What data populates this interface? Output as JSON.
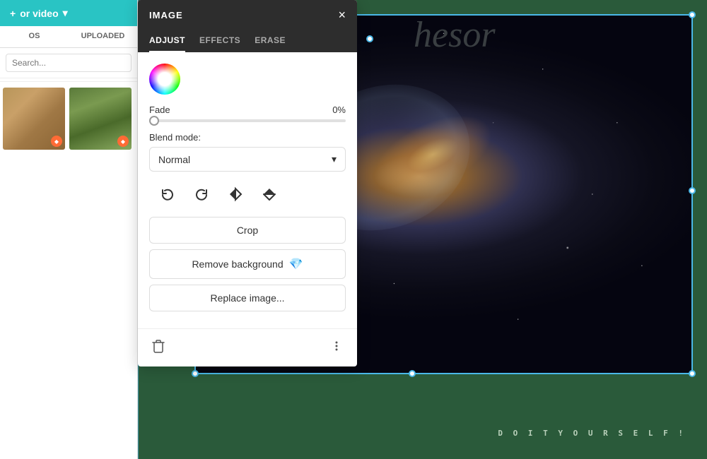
{
  "sidebar": {
    "top_button": "or video",
    "tabs": [
      {
        "label": "OS",
        "active": false
      },
      {
        "label": "UPLOADED",
        "active": false
      }
    ],
    "search_placeholder": "Search...",
    "images": [
      {
        "id": "rocks",
        "type": "rocks",
        "has_badge": true
      },
      {
        "id": "aerial",
        "type": "aerial",
        "has_badge": true
      }
    ]
  },
  "panel": {
    "title": "IMAGE",
    "close_label": "×",
    "tabs": [
      {
        "label": "ADJUST",
        "active": true
      },
      {
        "label": "EFFECTS",
        "active": false
      },
      {
        "label": "ERASE",
        "active": false
      }
    ],
    "fade_label": "Fade",
    "fade_value": "0%",
    "blend_label": "Blend mode:",
    "blend_value": "Normal",
    "blend_chevron": "▾",
    "transform_icons": [
      {
        "name": "rotate-ccw",
        "symbol": "↺"
      },
      {
        "name": "rotate-cw",
        "symbol": "↻"
      },
      {
        "name": "flip-h",
        "symbol": "◭"
      },
      {
        "name": "flip-v",
        "symbol": "⏴"
      }
    ],
    "buttons": [
      {
        "name": "crop",
        "label": "Crop",
        "has_gem": false
      },
      {
        "name": "remove-background",
        "label": "Remove background",
        "has_gem": true
      },
      {
        "name": "replace-image",
        "label": "Replace image...",
        "has_gem": false
      }
    ],
    "footer": {
      "trash_icon": "🗑",
      "more_icon": "⋮"
    }
  },
  "canvas": {
    "top_text": "hesor",
    "bottom_text": "D O  I T  Y O U R S E L F !"
  }
}
